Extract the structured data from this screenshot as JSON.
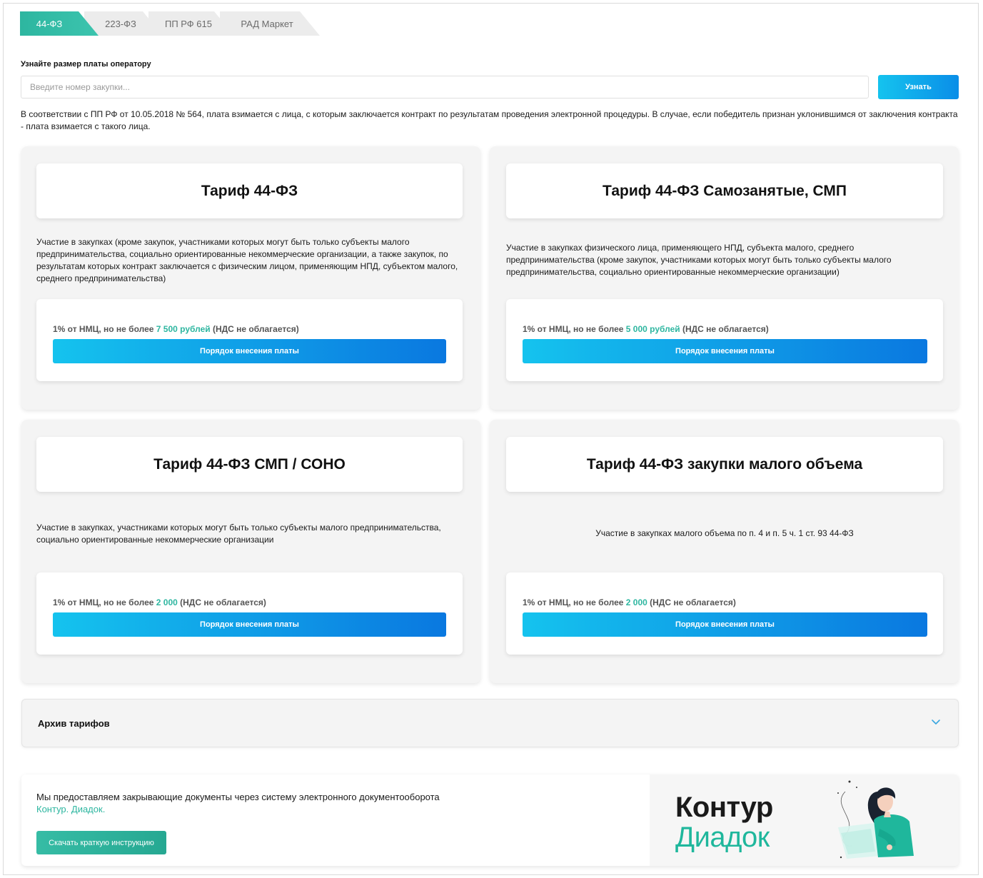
{
  "tabs": [
    {
      "label": "44-ФЗ",
      "active": true
    },
    {
      "label": "223-ФЗ",
      "active": false
    },
    {
      "label": "ПП РФ 615",
      "active": false
    },
    {
      "label": "РАД Маркет",
      "active": false
    }
  ],
  "fee_lookup": {
    "label": "Узнайте размер платы оператору",
    "placeholder": "Введите номер закупки...",
    "value": "",
    "button": "Узнать"
  },
  "notice": "В соответствии с ПП РФ от 10.05.2018 № 564, плата взимается с лица, с которым заключается контракт по результатам проведения электронной процедуры. В случае, если победитель признан уклонившимся от заключения контракта - плата взимается с такого лица.",
  "tariffs": [
    {
      "title": "Тариф 44-ФЗ",
      "description": "Участие в закупках (кроме закупок, участниками которых могут быть только субъекты малого предпринимательства, социально ориентированные некоммерческие организации, а также закупок, по результатам которых контракт заключается с физическим лицом, применяющим НПД, субъектом малого, среднего предпринимательства)",
      "price_prefix": "1% от НМЦ, но не более ",
      "price_amount": "7 500 рублей",
      "price_suffix": " (НДС не облагается)",
      "button": "Порядок внесения платы"
    },
    {
      "title": "Тариф 44-ФЗ Самозанятые, СМП",
      "description": "Участие в закупках физического лица, применяющего НПД, субъекта малого, среднего предпринимательства (кроме закупок, участниками которых могут быть только субъекты малого предпринимательства, социально ориентированные некоммерческие организации)",
      "price_prefix": "1% от НМЦ, но не более ",
      "price_amount": "5 000 рублей",
      "price_suffix": " (НДС не облагается)",
      "button": "Порядок внесения платы"
    },
    {
      "title": "Тариф 44-ФЗ СМП / СОНО",
      "description": "Участие в закупках, участниками которых могут быть только субъекты малого предпринимательства, социально ориентированные некоммерческие организации",
      "price_prefix": "1% от НМЦ, но не более ",
      "price_amount": "2 000",
      "price_suffix": " (НДС не облагается)",
      "button": "Порядок внесения платы"
    },
    {
      "title": "Тариф 44-ФЗ закупки малого объема",
      "description": "Участие в закупках малого объема по п. 4 и п. 5 ч. 1 ст. 93 44-ФЗ",
      "price_prefix": "1% от НМЦ, но не более ",
      "price_amount": "2 000",
      "price_suffix": " (НДС не облагается)",
      "button": "Порядок внесения платы"
    }
  ],
  "archive": {
    "title": "Архив тарифов",
    "icon": "chevron-down-icon"
  },
  "banner": {
    "text": "Мы предоставляем закрывающие документы через систему электронного документооборота",
    "link": "Контур. Диадок.",
    "button": "Скачать краткую инструкцию",
    "logo_line1": "Контур",
    "logo_line2": "Диадок"
  },
  "colors": {
    "accent_green": "#2db6a0",
    "accent_blue": "#0a8ee8",
    "diadok_green": "#1fb79c"
  }
}
